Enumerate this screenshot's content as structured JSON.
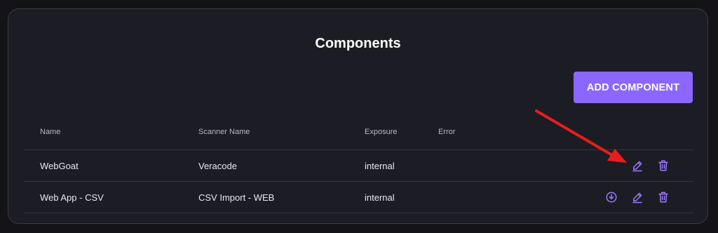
{
  "page": {
    "title": "Components"
  },
  "toolbar": {
    "add_label": "ADD COMPONENT"
  },
  "table": {
    "headers": [
      "Name",
      "Scanner Name",
      "Exposure",
      "Error"
    ],
    "rows": [
      {
        "name": "WebGoat",
        "scanner": "Veracode",
        "exposure": "internal",
        "error": ""
      },
      {
        "name": "Web App - CSV",
        "scanner": "CSV Import - WEB",
        "exposure": "internal",
        "error": ""
      }
    ]
  },
  "colors": {
    "accent": "#8b66ff",
    "icon": "#9b7cff",
    "annotation_arrow": "#e41e1e"
  },
  "icons": {
    "download": "download-circle-icon",
    "edit": "pencil-icon",
    "delete": "trash-icon"
  }
}
